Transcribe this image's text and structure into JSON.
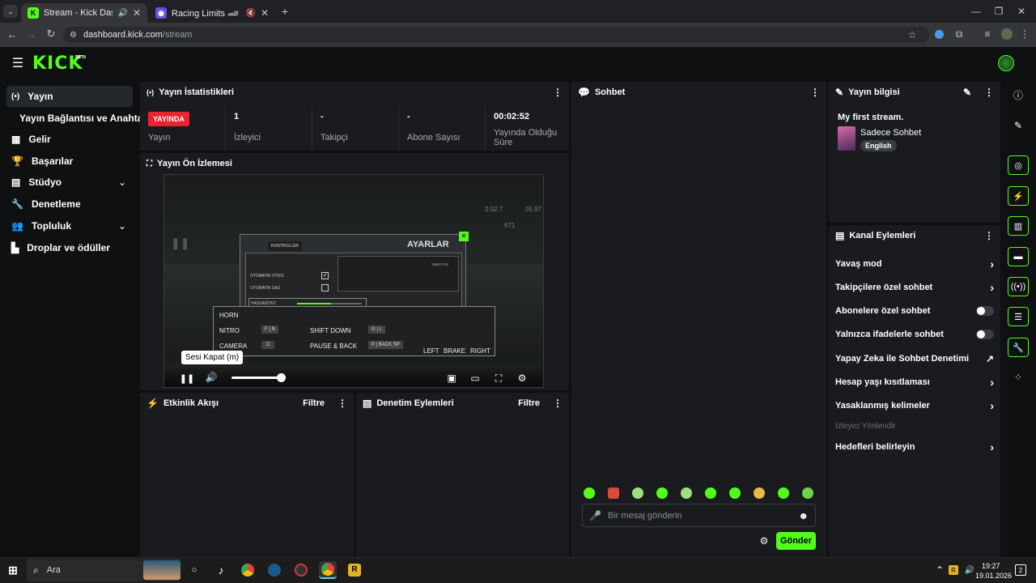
{
  "browser": {
    "tabs": [
      {
        "title": "Stream - Kick Dashboard",
        "active": true
      },
      {
        "title": "Racing Limits 🏎 Play on C",
        "active": false
      }
    ],
    "url_host": "dashboard.kick.com",
    "url_path": "/stream"
  },
  "brand": {
    "logo": "KICK",
    "beta": "BETA",
    "accent": "#53fc18"
  },
  "sidebar": {
    "items": [
      {
        "label": "Yayın",
        "icon": "broadcast-icon"
      },
      {
        "label": "Yayın Bağlantısı ve Anahtarı",
        "icon": ""
      },
      {
        "label": "Gelir",
        "icon": "revenue-icon"
      },
      {
        "label": "Başarılar",
        "icon": "trophy-icon"
      },
      {
        "label": "Stüdyo",
        "icon": "studio-icon"
      },
      {
        "label": "Denetleme",
        "icon": "wrench-icon"
      },
      {
        "label": "Topluluk",
        "icon": "community-icon"
      },
      {
        "label": "Droplar ve ödüller",
        "icon": "drops-icon"
      }
    ]
  },
  "stats": {
    "title": "Yayın İstatistikleri",
    "live_badge": "YAYINDA",
    "live_label": "Yayın",
    "viewers_value": "1",
    "viewers_label": "İzleyici",
    "followers_value": "-",
    "followers_label": "Takipçi",
    "subs_value": "-",
    "subs_label": "Abone Sayısı",
    "uptime_value": "00:02:52",
    "uptime_label_1": "Yayında Olduğu",
    "uptime_label_2": "Süre"
  },
  "preview": {
    "title": "Yayın Ön İzlemesi",
    "tooltip": "Sesi Kapat (m)",
    "volume": 1.0,
    "game": {
      "settings_title": "AYARLAR",
      "tab": "KONTROLLER",
      "auto_gear": "OTOMATİK VİTES",
      "auto_gas": "OTOMATİK GAZ",
      "sensitivity": "HASSASİYET",
      "horn": "HORN",
      "nitro": "NITRO",
      "nitro_key": "F | N",
      "camera": "CAMERA",
      "camera_key": "C",
      "shift_down": "SHIFT DOWN",
      "shift_down_key": "G | L",
      "pause_back": "PAUSE & BACK",
      "pause_back_key": "P | BACK SP",
      "left": "LEFT",
      "brake": "BRAKE",
      "right": "RIGHT",
      "throttle": "THROTTLE",
      "hud_time": "2:02.7",
      "hud_best": "05.97",
      "hud_speed": "671"
    }
  },
  "activity": {
    "title": "Etkinlik Akışı",
    "filter": "Filtre"
  },
  "modlog": {
    "title": "Denetim Eylemleri",
    "filter": "Filtre"
  },
  "chat": {
    "title": "Sohbet",
    "placeholder": "Bir mesaj gönderin",
    "send": "Gönder"
  },
  "streaminfo": {
    "title": "Yayın bilgisi",
    "stream_title": "My first stream.",
    "category": "Sadece Sohbet",
    "language": "English"
  },
  "channel_actions": {
    "title": "Kanal Eylemleri",
    "items": [
      {
        "label": "Yavaş mod",
        "control": "chevron"
      },
      {
        "label": "Takipçilere özel sohbet",
        "control": "chevron"
      },
      {
        "label": "Abonelere özel sohbet",
        "control": "toggle"
      },
      {
        "label": "Yalnızca ifadelerle sohbet",
        "control": "toggle"
      },
      {
        "label": "Yapay Zeka ile Sohbet Denetimi",
        "control": "external"
      },
      {
        "label": "Hesap yaşı kısıtlaması",
        "control": "chevron"
      },
      {
        "label": "Yasaklanmış kelimeler",
        "control": "chevron"
      }
    ],
    "disabled_item": "İzleyici Yönlendir",
    "last_item": "Hedefleri belirleyin"
  },
  "taskbar": {
    "search": "Ara",
    "time": "19:27",
    "date": "19.01.2026",
    "notifications": "2"
  }
}
